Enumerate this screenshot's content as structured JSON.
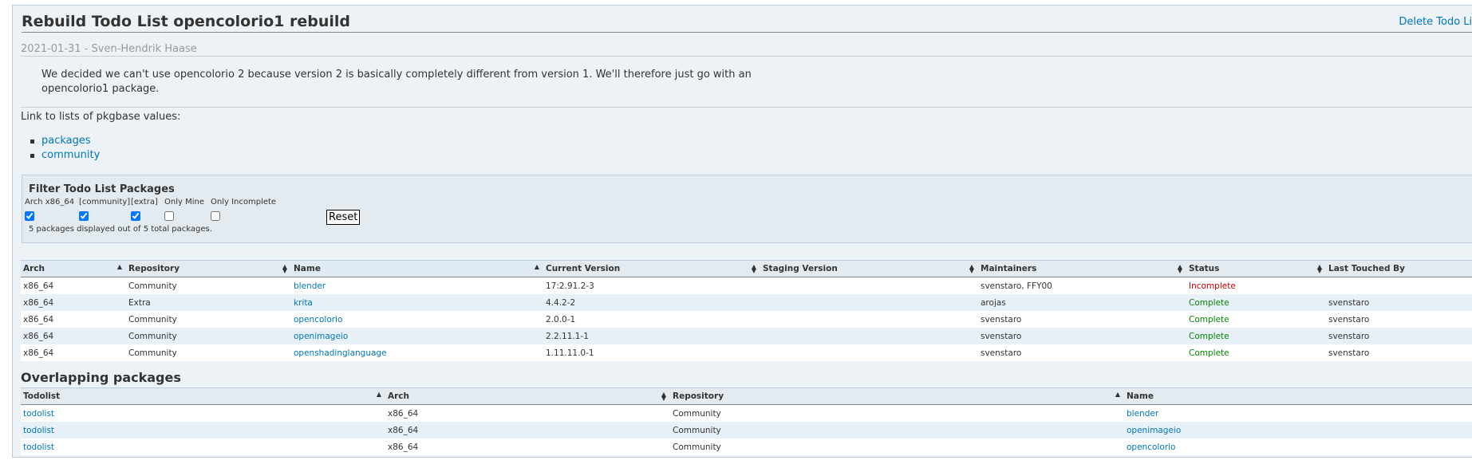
{
  "page": {
    "title": "Rebuild Todo List opencolorio1 rebuild",
    "delete_link": "Delete Todo List",
    "meta": "2021-01-31 - Sven-Hendrik Haase",
    "description": "We decided we can't use opencolorio 2 because version 2 is basically completely different from version 1. We'll therefore just go with an opencolorio1 package.",
    "link_intro": "Link to lists of pkgbase values:",
    "links": [
      "packages",
      "community"
    ]
  },
  "filter": {
    "title": "Filter Todo List Packages",
    "options": [
      {
        "label": "Arch x86_64",
        "checked": true
      },
      {
        "label": "[community]",
        "checked": true
      },
      {
        "label": "[extra]",
        "checked": true
      },
      {
        "label": "Only Mine",
        "checked": false
      },
      {
        "label": "Only Incomplete",
        "checked": false
      }
    ],
    "reset_label": "Reset",
    "count_text": "5 packages displayed out of 5 total packages."
  },
  "packages_table": {
    "headers": [
      "Arch",
      "Repository",
      "Name",
      "Current Version",
      "Staging Version",
      "Maintainers",
      "Status",
      "Last Touched By"
    ],
    "rows": [
      {
        "arch": "x86_64",
        "repo": "Community",
        "name": "blender",
        "version": "17:2.91.2-3",
        "staging": "",
        "maintainers": "svenstaro, FFY00",
        "status": "Incomplete",
        "touched": ""
      },
      {
        "arch": "x86_64",
        "repo": "Extra",
        "name": "krita",
        "version": "4.4.2-2",
        "staging": "",
        "maintainers": "arojas",
        "status": "Complete",
        "touched": "svenstaro"
      },
      {
        "arch": "x86_64",
        "repo": "Community",
        "name": "opencolorio",
        "version": "2.0.0-1",
        "staging": "",
        "maintainers": "svenstaro",
        "status": "Complete",
        "touched": "svenstaro"
      },
      {
        "arch": "x86_64",
        "repo": "Community",
        "name": "openimageio",
        "version": "2.2.11.1-1",
        "staging": "",
        "maintainers": "svenstaro",
        "status": "Complete",
        "touched": "svenstaro"
      },
      {
        "arch": "x86_64",
        "repo": "Community",
        "name": "openshadinglanguage",
        "version": "1.11.11.0-1",
        "staging": "",
        "maintainers": "svenstaro",
        "status": "Complete",
        "touched": "svenstaro"
      }
    ]
  },
  "overlap": {
    "title": "Overlapping packages",
    "headers": [
      "Todolist",
      "Arch",
      "Repository",
      "Name"
    ],
    "rows": [
      {
        "todolist": "todolist",
        "arch": "x86_64",
        "repo": "Community",
        "name": "blender"
      },
      {
        "todolist": "todolist",
        "arch": "x86_64",
        "repo": "Community",
        "name": "openimageio"
      },
      {
        "todolist": "todolist",
        "arch": "x86_64",
        "repo": "Community",
        "name": "opencolorio"
      }
    ]
  },
  "colors": {
    "link": "#0077bb",
    "incomplete": "#cc0000",
    "complete": "#008800",
    "box_bg": "#ecf2f5"
  }
}
